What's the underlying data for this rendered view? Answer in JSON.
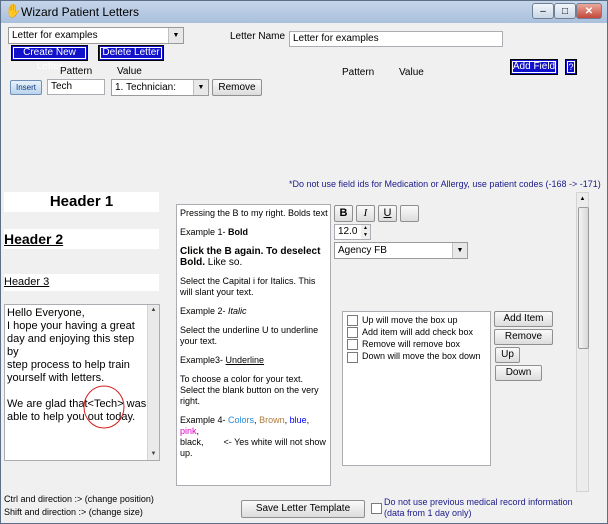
{
  "window": {
    "title": "Wizard Patient Letters",
    "minimize": "–",
    "maximize": "□",
    "close": "✕"
  },
  "toolbar": {
    "letter_select": "Letter for examples",
    "letter_name_label": "Letter Name",
    "letter_name_value": "Letter for examples",
    "create_button": "Create New Letter",
    "delete_button": "Delete Letter",
    "pattern_header": "Pattern",
    "value_header": "Value",
    "pattern_header_right": "Pattern",
    "value_header_right": "Value",
    "add_field_button": "Add Field",
    "help_button": "?",
    "insert_button": "Insert",
    "pattern_value": "Tech",
    "value_select": "1. Technician:",
    "remove_button": "Remove"
  },
  "warning": "*Do not use field ids for Medication or Allergy, use patient codes (-168 -> -171)",
  "headers": {
    "h1": "Header 1",
    "h2": "Header 2",
    "h3": "Header 3"
  },
  "body_text": {
    "line1": "Hello Everyone,",
    "line2": "I hope your having a great",
    "line3": "day and enjoying this step by",
    "line4": "step process to help train",
    "line5": "yourself with letters.",
    "line6a": "We are glad that",
    "line6b": "<Tech>",
    "line6c": " was",
    "line7": "able to help you out today."
  },
  "instructions": {
    "p1": "Pressing the B to my right. Bolds text",
    "p2a": "Example 1- ",
    "p2b": "Bold",
    "p3a": "Click the B again. To deselect Bold.",
    "p3b": " Like so.",
    "p4": "Select the Capital i for Italics. This will slant your text.",
    "p5a": "Example 2- ",
    "p5b": "Italic",
    "p6": "Select the underline U to underline your text.",
    "p7a": "Example3- ",
    "p7b": "Underline",
    "p8": "To choose a color for your text. Select the blank button on the very right.",
    "p9a": "Example 4- ",
    "p9b": "Colors",
    "p9c": ", ",
    "p9d": "Brown",
    "p9e": ", ",
    "p9f": "blue",
    "p9g": ", ",
    "p9h": "pink",
    "p9i": ",",
    "p9j": "black,",
    "p9k": "<- Yes white will not show up."
  },
  "format": {
    "bold": "B",
    "italic": "I",
    "underline": "U",
    "font_size": "12.0",
    "font_family": "Agency FB"
  },
  "checklist": {
    "items": [
      "Up will move the box up",
      "Add item will add check box",
      "Remove will remove box",
      "Down will move the box down"
    ],
    "add_item": "Add Item",
    "remove": "Remove",
    "up": "Up",
    "down": "Down"
  },
  "footer": {
    "hint1": "Ctrl and direction :> (change position)",
    "hint2": "Shift and direction :> (change size)",
    "save_button": "Save Letter Template",
    "checkbox_label_1": "Do not use previous medical record information",
    "checkbox_label_2": "(data from 1 day only)"
  },
  "colors": {
    "blue_button": "#1111cc",
    "brown": "#b07a3a",
    "blue": "#0000ff",
    "pink": "#e000c8",
    "color_word": "#2a8ad8",
    "annotation_red": "#d32020"
  }
}
